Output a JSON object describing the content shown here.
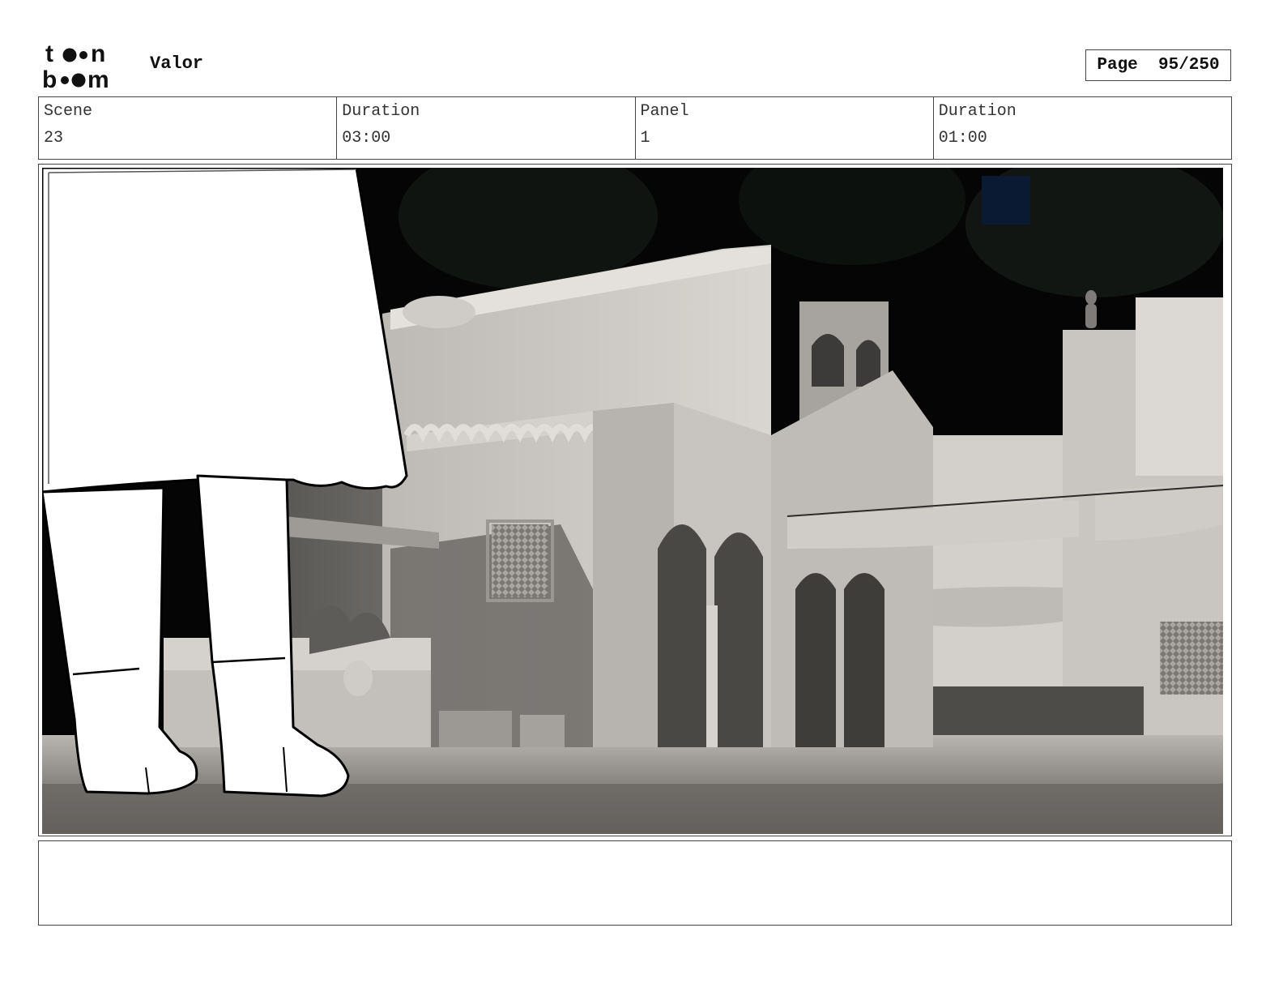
{
  "header": {
    "logo_text": [
      "toon",
      "boom"
    ],
    "project_title": "Valor",
    "page_label": "Page",
    "page_value": "95/250"
  },
  "info": {
    "scene_label": "Scene",
    "scene_value": "23",
    "scene_duration_label": "Duration",
    "scene_duration_value": "03:00",
    "panel_label": "Panel",
    "panel_value": "1",
    "panel_duration_label": "Duration",
    "panel_duration_value": "01:00"
  },
  "panel": {
    "description": ""
  },
  "notes": {
    "text": ""
  }
}
